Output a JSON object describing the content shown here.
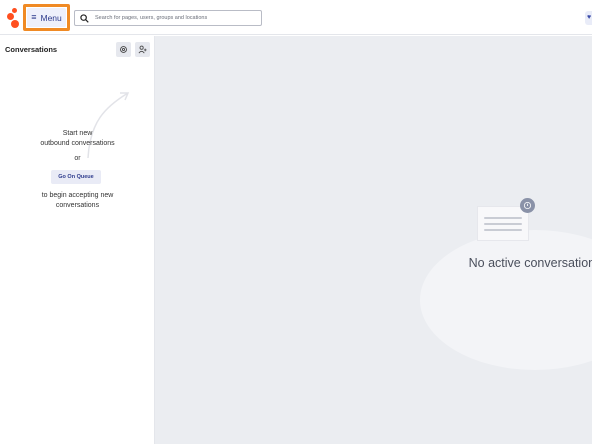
{
  "topbar": {
    "menu_label": "Menu",
    "search_placeholder": "Search for pages, users, groups and locations"
  },
  "sidebar": {
    "title": "Conversations",
    "hint_line1": "Start new",
    "hint_line2": "outbound conversations",
    "or_text": "or",
    "queue_button": "Go On Queue",
    "hint_line3": "to begin accepting new",
    "hint_line4": "conversations"
  },
  "main": {
    "empty_text": "No active conversations"
  },
  "colors": {
    "accent": "#2d3a8c",
    "brand": "#ff4f1f",
    "highlight": "#f08a24"
  }
}
